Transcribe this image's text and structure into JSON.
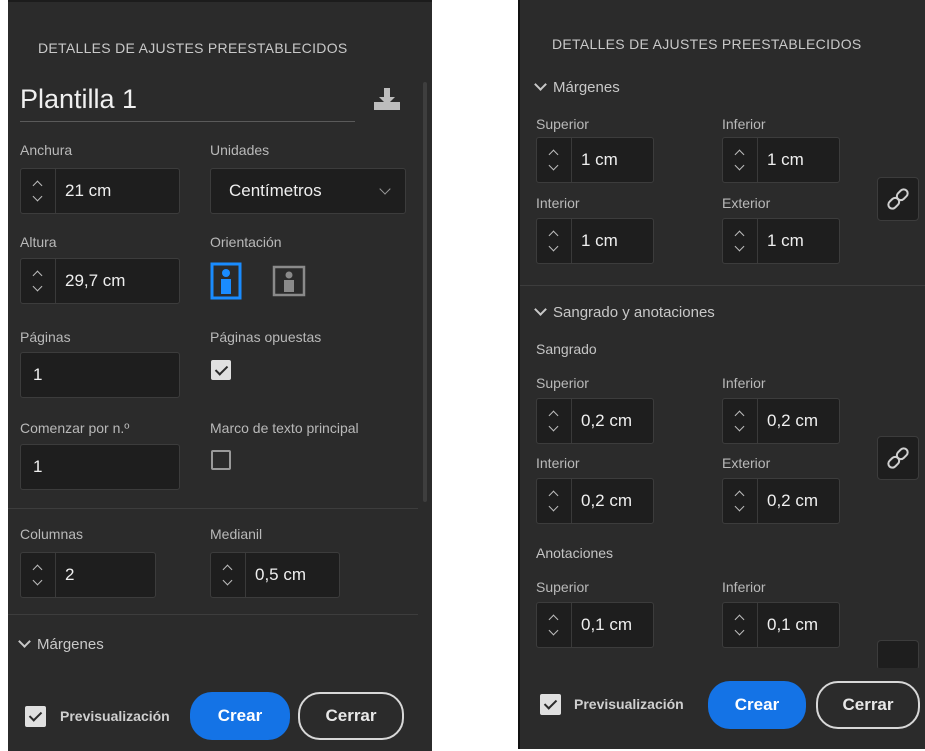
{
  "left": {
    "header": "DETALLES DE AJUSTES PREESTABLECIDOS",
    "preset_name": "Plantilla 1",
    "save_icon": "download-save-icon",
    "anchura": {
      "label": "Anchura",
      "value": "21 cm"
    },
    "unidades": {
      "label": "Unidades",
      "value": "Centímetros"
    },
    "altura": {
      "label": "Altura",
      "value": "29,7 cm"
    },
    "orientacion": {
      "label": "Orientación",
      "selected": "portrait"
    },
    "paginas": {
      "label": "Páginas",
      "value": "1"
    },
    "paginas_opuestas": {
      "label": "Páginas opuestas",
      "checked": true
    },
    "comenzar": {
      "label": "Comenzar por n.º",
      "value": "1"
    },
    "marco": {
      "label": "Marco de texto principal",
      "checked": false
    },
    "columnas": {
      "label": "Columnas",
      "value": "2"
    },
    "medianil": {
      "label": "Medianil",
      "value": "0,5 cm"
    },
    "margenes_section": "Márgenes",
    "preview_label": "Previsualización",
    "preview_checked": true,
    "create_label": "Crear",
    "close_label": "Cerrar"
  },
  "right": {
    "header": "DETALLES DE AJUSTES PREESTABLECIDOS",
    "margenes_section": "Márgenes",
    "margenes": {
      "superior": {
        "label": "Superior",
        "value": "1 cm"
      },
      "inferior": {
        "label": "Inferior",
        "value": "1 cm"
      },
      "interior": {
        "label": "Interior",
        "value": "1 cm"
      },
      "exterior": {
        "label": "Exterior",
        "value": "1 cm"
      }
    },
    "sangrado_section": "Sangrado y anotaciones",
    "sangrado_label": "Sangrado",
    "sangrado": {
      "superior": {
        "label": "Superior",
        "value": "0,2 cm"
      },
      "inferior": {
        "label": "Inferior",
        "value": "0,2 cm"
      },
      "interior": {
        "label": "Interior",
        "value": "0,2 cm"
      },
      "exterior": {
        "label": "Exterior",
        "value": "0,2 cm"
      }
    },
    "anotaciones_label": "Anotaciones",
    "anotaciones": {
      "superior": {
        "label": "Superior",
        "value": "0,1 cm"
      },
      "inferior": {
        "label": "Inferior",
        "value": "0,1 cm"
      }
    },
    "preview_label": "Previsualización",
    "preview_checked": true,
    "create_label": "Crear",
    "close_label": "Cerrar"
  },
  "colors": {
    "accent": "#1473e6",
    "panel_bg": "#2b2b2b",
    "field_bg": "#1e1e1e"
  }
}
